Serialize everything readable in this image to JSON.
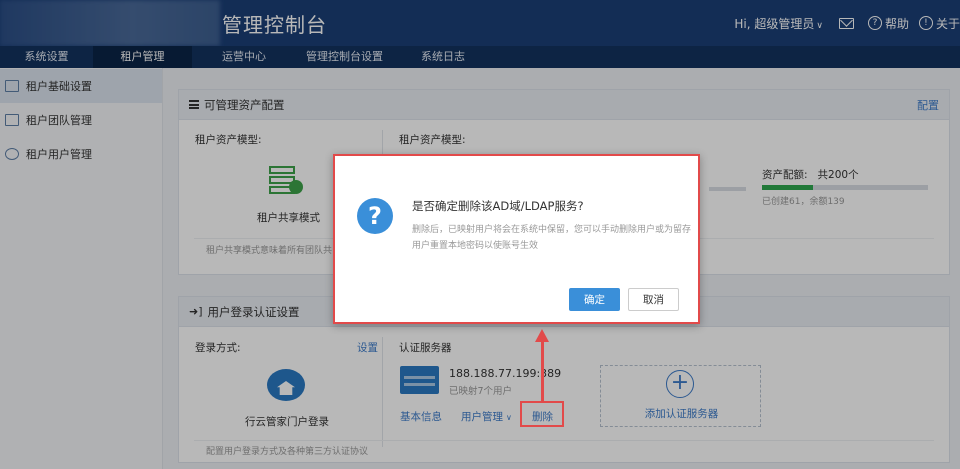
{
  "header": {
    "title": "管理控制台",
    "greeting": "Hi, 超级管理员",
    "greeting_caret": "∨",
    "help_label": "帮助",
    "about_label": "关于",
    "help_glyph": "?",
    "about_glyph": "!"
  },
  "nav": {
    "items": [
      "系统设置",
      "租户管理",
      "运营中心",
      "管理控制台设置",
      "系统日志"
    ],
    "active_index": 1
  },
  "sidebar": {
    "items": [
      "租户基础设置",
      "租户团队管理",
      "租户用户管理"
    ],
    "active_index": 0
  },
  "asset_panel": {
    "title": "可管理资产配置",
    "config_link": "配置",
    "left_label": "租户资产模型:",
    "right_label": "租户资产模型:",
    "shared_mode": "租户共享模式",
    "shared_note": "租户共享模式意味着所有团队共",
    "quota_label": "资产配额:",
    "quota_total": "共200个",
    "quota_detail": "已创建61，余额139",
    "quota_fraction": 0.305
  },
  "login_panel": {
    "title": "用户登录认证设置",
    "method_label": "登录方式:",
    "method_link": "设置",
    "method_name": "行云管家门户登录",
    "footer_note": "配置用户登录方式及各种第三方认证协议",
    "server_label": "认证服务器",
    "server_ip": "188.188.77.199:389",
    "server_mapped": "已映射7个用户",
    "server_basic": "基本信息",
    "server_users": "用户管理",
    "server_delete": "删除",
    "add_server": "添加认证服务器",
    "add_glyph": "+"
  },
  "dialog": {
    "icon_glyph": "?",
    "title": "是否确定删除该AD域/LDAP服务?",
    "description": "删除后，已映射用户将会在系统中保留，您可以手动删除用户或为留存用户重置本地密码以使账号生效",
    "ok_label": "确定",
    "cancel_label": "取消"
  },
  "colors": {
    "header_bg": "#1b3f77",
    "nav_bg": "#12325f",
    "accent": "#3a8fd9",
    "annotation": "#e24a4a",
    "quota_fill": "#2fa84f"
  }
}
